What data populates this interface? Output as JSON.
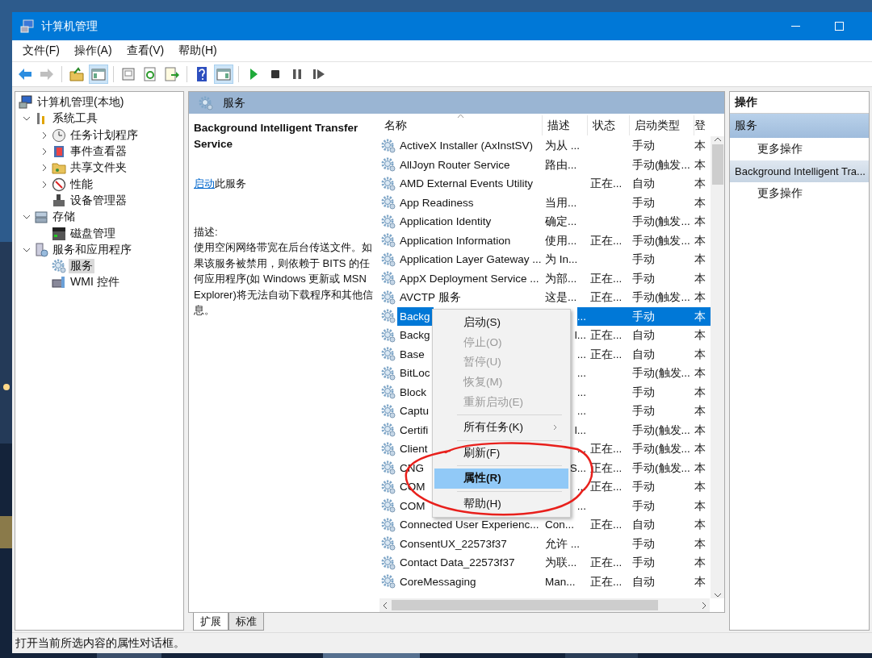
{
  "window": {
    "title": "计算机管理"
  },
  "menu": [
    {
      "label": "文件(F)"
    },
    {
      "label": "操作(A)"
    },
    {
      "label": "查看(V)"
    },
    {
      "label": "帮助(H)"
    }
  ],
  "toolbar": [
    {
      "kind": "back",
      "disabled": false,
      "pressed": false
    },
    {
      "kind": "forward",
      "disabled": true,
      "pressed": false
    },
    {
      "kind": "sep"
    },
    {
      "kind": "up",
      "disabled": false,
      "pressed": false
    },
    {
      "kind": "tree_pane",
      "disabled": false,
      "pressed": true
    },
    {
      "kind": "sep"
    },
    {
      "kind": "properties",
      "disabled": false,
      "pressed": false
    },
    {
      "kind": "refresh",
      "disabled": false,
      "pressed": false
    },
    {
      "kind": "export",
      "disabled": false,
      "pressed": false
    },
    {
      "kind": "sep"
    },
    {
      "kind": "help",
      "disabled": false,
      "pressed": false
    },
    {
      "kind": "action_pane",
      "disabled": false,
      "pressed": true
    },
    {
      "kind": "sep"
    },
    {
      "kind": "play",
      "disabled": false,
      "pressed": false
    },
    {
      "kind": "stop",
      "disabled": false,
      "pressed": false
    },
    {
      "kind": "pause",
      "disabled": false,
      "pressed": false
    },
    {
      "kind": "resume",
      "disabled": false,
      "pressed": false
    }
  ],
  "tree": [
    {
      "label": "计算机管理(本地)",
      "selected": false,
      "children": [
        {
          "label": "系统工具",
          "expanded": true,
          "selected": false,
          "children": [
            {
              "label": "任务计划程序",
              "expanded": false,
              "selected": false
            },
            {
              "label": "事件查看器",
              "expanded": false,
              "selected": false
            },
            {
              "label": "共享文件夹",
              "expanded": false,
              "selected": false
            },
            {
              "label": "性能",
              "expanded": false,
              "selected": false
            },
            {
              "label": "设备管理器",
              "selected": false
            }
          ]
        },
        {
          "label": "存储",
          "expanded": true,
          "selected": false,
          "children": [
            {
              "label": "磁盘管理",
              "selected": false
            }
          ]
        },
        {
          "label": "服务和应用程序",
          "expanded": true,
          "selected": false,
          "children": [
            {
              "label": "服务",
              "selected": true
            },
            {
              "label": "WMI 控件",
              "selected": false
            }
          ]
        }
      ]
    }
  ],
  "center": {
    "header": "服务",
    "detail": {
      "title": "Background Intelligent Transfer Service",
      "action_link": "启动",
      "action_text": "此服务",
      "description_label": "描述:",
      "description": "使用空闲网络带宽在后台传送文件。如果该服务被禁用，则依赖于 BITS 的任何应用程序(如 Windows 更新或 MSN Explorer)将无法自动下载程序和其他信息。"
    },
    "table": {
      "columns": [
        "名称",
        "描述",
        "状态",
        "启动类型",
        "登"
      ],
      "rows": [
        {
          "kind": "full",
          "name": "ActiveX Installer (AxInstSV)",
          "description": "为从 ...",
          "startup": "手动",
          "column_5": "本",
          "selected": false
        },
        {
          "kind": "full",
          "name": "AllJoyn Router Service",
          "description": "路由...",
          "startup": "手动(触发...",
          "column_5": "本",
          "selected": false
        },
        {
          "kind": "full",
          "name": "AMD External Events Utility",
          "status": "正在...",
          "startup": "自动",
          "column_5": "本",
          "selected": false
        },
        {
          "kind": "full",
          "name": "App Readiness",
          "description": "当用...",
          "startup": "手动",
          "column_5": "本",
          "selected": false
        },
        {
          "kind": "full",
          "name": "Application Identity",
          "description": "确定...",
          "startup": "手动(触发...",
          "column_5": "本",
          "selected": false
        },
        {
          "kind": "full",
          "name": "Application Information",
          "description": "使用...",
          "status": "正在...",
          "startup": "手动(触发...",
          "column_5": "本",
          "selected": false
        },
        {
          "kind": "full",
          "name": "Application Layer Gateway ...",
          "description": "为 In...",
          "startup": "手动",
          "column_5": "本",
          "selected": false
        },
        {
          "kind": "full",
          "name": "AppX Deployment Service ...",
          "description": "为部...",
          "status": "正在...",
          "startup": "手动",
          "column_5": "本",
          "selected": false
        },
        {
          "kind": "full",
          "name": "AVCTP 服务",
          "description": "这是...",
          "status": "正在...",
          "startup": "手动(触发...",
          "column_5": "本",
          "selected": false
        },
        {
          "kind": "under_menu",
          "name": "Backg",
          "description": "...",
          "startup": "手动",
          "column_5": "本",
          "selected": true
        },
        {
          "kind": "under_menu",
          "name": "Backg",
          "description": "l...",
          "status": "正在...",
          "startup": "自动",
          "column_5": "本",
          "selected": false
        },
        {
          "kind": "under_menu",
          "name": "Base",
          "description": "...",
          "status": "正在...",
          "startup": "自动",
          "column_5": "本",
          "selected": false
        },
        {
          "kind": "under_menu",
          "name": "BitLoc",
          "description": "...",
          "startup": "手动(触发...",
          "column_5": "本",
          "selected": false
        },
        {
          "kind": "under_menu",
          "name": "Block",
          "description": "...",
          "startup": "手动",
          "column_5": "本",
          "selected": false
        },
        {
          "kind": "under_menu",
          "name": "Captu",
          "description": "...",
          "startup": "手动",
          "column_5": "本",
          "selected": false
        },
        {
          "kind": "under_menu",
          "name": "Certifi",
          "description": "l...",
          "startup": "手动(触发...",
          "column_5": "本",
          "selected": false
        },
        {
          "kind": "under_menu",
          "name": "Client",
          "description": "...",
          "status": "正在...",
          "startup": "手动(触发...",
          "column_5": "本",
          "selected": false
        },
        {
          "kind": "under_menu",
          "name": "CNG",
          "description": "S...",
          "status": "正在...",
          "startup": "手动(触发...",
          "column_5": "本",
          "selected": false
        },
        {
          "kind": "under_menu",
          "name": "COM",
          "description": "...",
          "status": "正在...",
          "startup": "手动",
          "column_5": "本",
          "selected": false
        },
        {
          "kind": "under_menu",
          "name": "COM",
          "description": "...",
          "startup": "手动",
          "column_5": "本",
          "selected": false
        },
        {
          "kind": "full",
          "name": "Connected User Experienc...",
          "description": "Con...",
          "status": "正在...",
          "startup": "自动",
          "column_5": "本",
          "selected": false
        },
        {
          "kind": "full",
          "name": "ConsentUX_22573f37",
          "description": "允许 ...",
          "startup": "手动",
          "column_5": "本",
          "selected": false
        },
        {
          "kind": "full",
          "name": "Contact Data_22573f37",
          "description": "为联...",
          "status": "正在...",
          "startup": "手动",
          "column_5": "本",
          "selected": false
        },
        {
          "kind": "full",
          "name": "CoreMessaging",
          "description": "Man...",
          "status": "正在...",
          "startup": "自动",
          "column_5": "本",
          "selected": false
        }
      ]
    },
    "tabs": [
      {
        "label": "扩展",
        "selected": true
      },
      {
        "label": "标准",
        "selected": false
      }
    ]
  },
  "actions": {
    "title": "操作",
    "sections": [
      {
        "title": "服务",
        "selected": false,
        "items": [
          "更多操作"
        ]
      },
      {
        "title": "Background Intelligent Tra...",
        "selected": true,
        "items": [
          "更多操作"
        ]
      }
    ]
  },
  "context_menu": [
    {
      "kind": "item",
      "label": "启动(S)",
      "disabled": false,
      "highlighted": false
    },
    {
      "kind": "item",
      "label": "停止(O)",
      "disabled": true,
      "highlighted": false
    },
    {
      "kind": "item",
      "label": "暂停(U)",
      "disabled": true,
      "highlighted": false
    },
    {
      "kind": "item",
      "label": "恢复(M)",
      "disabled": true,
      "highlighted": false
    },
    {
      "kind": "item",
      "label": "重新启动(E)",
      "disabled": true,
      "highlighted": false
    },
    {
      "kind": "separator"
    },
    {
      "kind": "submenu",
      "label": "所有任务(K)",
      "disabled": false,
      "highlighted": false
    },
    {
      "kind": "separator"
    },
    {
      "kind": "item",
      "label": "刷新(F)",
      "disabled": false,
      "highlighted": false
    },
    {
      "kind": "separator"
    },
    {
      "kind": "item",
      "label": "属性(R)",
      "disabled": false,
      "highlighted": true
    },
    {
      "kind": "separator"
    },
    {
      "kind": "item",
      "label": "帮助(H)",
      "disabled": false,
      "highlighted": false
    }
  ],
  "annotation": {
    "kind": "freehand_circle"
  },
  "status_bar": "打开当前所选内容的属性对话框。"
}
